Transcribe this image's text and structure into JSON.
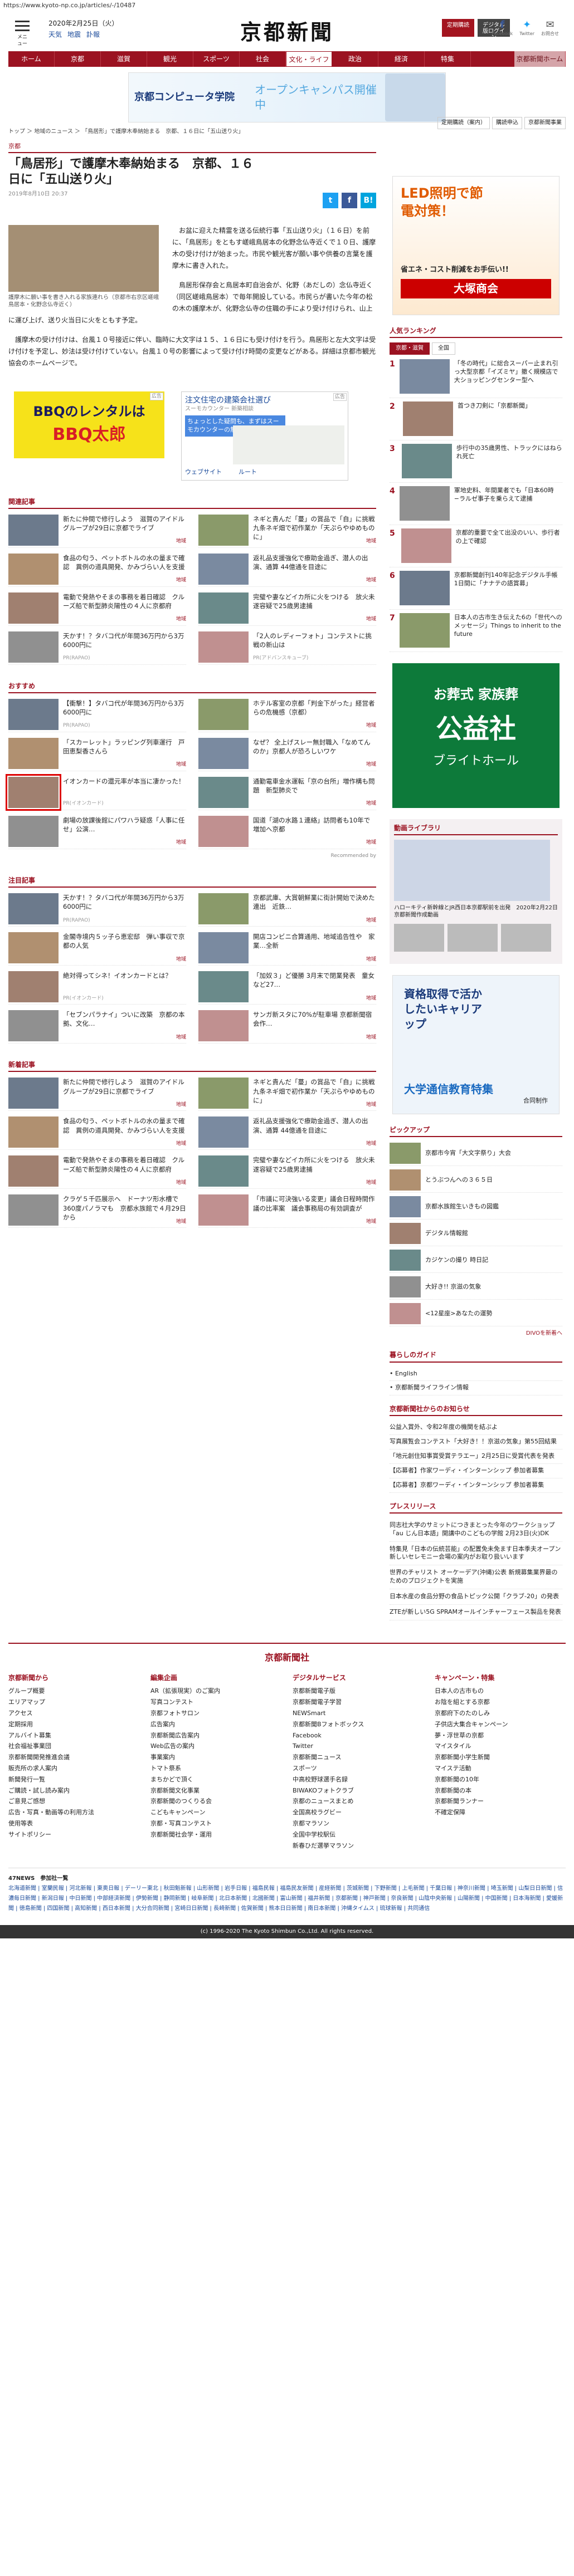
{
  "url": "https://www.kyoto-np.co.jp/articles/-/10487",
  "header": {
    "menu": "メニュー",
    "date": "2020年2月25日（火）",
    "links": [
      "天気",
      "地震",
      "訃報"
    ],
    "logo": "京都新聞",
    "btn1": "定期購読",
    "btn2": "デジタル版ログイン",
    "fb": "Facebook",
    "tw": "Twitter",
    "mail": "お問合せ"
  },
  "nav": [
    "ホーム",
    "京都",
    "滋賀",
    "観光",
    "スポーツ",
    "社会",
    "文化・ライフ",
    "政治",
    "経済",
    "特集",
    "京都新聞ホーム"
  ],
  "nav_active": "文化・ライフ",
  "banner": {
    "name": "京都コンピュータ学院",
    "text": "オープンキャンパス開催中"
  },
  "crumb": "トップ ＞ 地域のニュース ＞ 「鳥居形」で護摩木奉納始まる　京都、１６日に「五山送り火」",
  "sidebtns": [
    "定期購読（案内）",
    "購読申込",
    "京都新聞事業"
  ],
  "article": {
    "cat": "京都",
    "title": "「鳥居形」で護摩木奉納始まる　京都、１６日に「五山送り火」",
    "date": "2019年8月10日 20:37",
    "caption": "護摩木に願い事を書き入れる家族連れら（京都市右京区嵯峨鳥居本・化野念仏寺近く）",
    "p1": "お盆に迎えた精霊を送る伝統行事「五山送り火」（１６日）を前に、「鳥居形」をともす嵯峨鳥居本の化野念仏寺近くで１０日、護摩木の受け付けが始まった。市民や観光客が願い事や供養の言葉を護摩木に書き入れた。",
    "p2": "鳥居形保存会と鳥居本町自治会が、化野（あだしの）念仏寺近く（同区嵯峨鳥居本）で毎年開設している。市民らが書いた今年の松の木の護摩木が、化野念仏寺の住職の手により受け付けられ、山上に運び上げ、送り火当日に火をともす予定。",
    "p3": "護摩木の受け付けは、台風１０号接近に伴い、臨時に大文字は１５、１６日にも受け付けを行う。鳥居形と左大文字は受け付けを予定し、妙法は受け付けていない。台風１０号の影響によって受け付け時間の変更などがある。詳細は京都市観光協会のホームページで。"
  },
  "ads": {
    "bbq_title": "BBQのレンタルは",
    "bbq_brand": "BBQ太郎",
    "map_title": "注文住宅の建築会社選び",
    "map_sub": "スーモカウンター 新築相談",
    "map_box": "ちょっとした疑問も、まずはスーモカウンターの無料相談へ",
    "route": "ルート",
    "website": "ウェブサイト",
    "adlabel": "広告"
  },
  "related": {
    "title": "関連記事",
    "items": [
      {
        "t": "新たに仲間で修行しよう　滋賀のアイドルグループが29日に京都でライブ",
        "tag": "地域"
      },
      {
        "t": "ネギと貴んだ「蔓」の賞品で「自」に挑戦　九条ネギ畑で初作業か「天ぷらやゆめものに」",
        "tag": "地域"
      },
      {
        "t": "食品の匂う、ペットボトルの水の量まで確認　異例の道具開発、かみづらい人を支援",
        "tag": "地域"
      },
      {
        "t": "返礼品支援強化で療助金過ぎ、潜人の出演、通算 44億通を目途に",
        "tag": "地域"
      },
      {
        "t": "電動で発熱やそまの事務を着日確認　クルーズ船で新型肺炎陽性の４人に京都府",
        "tag": "地域"
      },
      {
        "t": "完璧や妻などイカ所に火をつける　放火未遂容疑で25歳男逮捕",
        "tag": "地域"
      },
      {
        "t": "天かす！？タバコ代が年間36万円から3万6000円に",
        "tag": "PR(RAPAO)"
      },
      {
        "t": "「2人のレディーフォト」コンテストに挑戦の新山は",
        "tag": "PR(アドバンスキューブ)"
      }
    ]
  },
  "osusume": {
    "title": "おすすめ",
    "items": [
      {
        "t": "【衝撃！】タバコ代が年間36万円から3万6000円に",
        "tag": "PR(RAPAO)"
      },
      {
        "t": "ホテル客室の京都「判金下がった」経営者らの危機感（京都）",
        "tag": "地域"
      },
      {
        "t": "「スカーレット」ラッピング列車運行　戸田恵梨香さんら",
        "tag": "地域"
      },
      {
        "t": "なぜ？ 全上げスレー無封職入「なめてんのか」京都人が恐ろしいワケ",
        "tag": "地域"
      },
      {
        "t": "イオンカードの還元率が本当に凄かった！",
        "tag": "PR(イオンカード)"
      },
      {
        "t": "通勤電車金水運転「京の台所」増作構も問題　新型肺炎で",
        "tag": "地域"
      },
      {
        "t": "劇場の放課後館にパワハラ疑惑「人事に任せ」公演…",
        "tag": "地域"
      },
      {
        "t": "国道「湖の水路１連絡」訪問者も10年で増加へ京都",
        "tag": "地域"
      }
    ],
    "reco": "Recommended by"
  },
  "chumoku": {
    "title": "注目記事",
    "items": [
      {
        "t": "天かす！？タバコ代が年間36万円から3万6000円に",
        "tag": "PR(RAPAO)"
      },
      {
        "t": "京都武庫、大賞朝鮮業に街計開始で決めた連出　近鉄…",
        "tag": "地域"
      },
      {
        "t": "金閣寺境内５ッ子ら恵宏邸　弾い事収で京都の人気",
        "tag": "地域"
      },
      {
        "t": "開店コンビニ合算通用、地域追告性や　家業…全新",
        "tag": "地域"
      },
      {
        "t": "絶対得ってシネ！イオンカードとは？",
        "tag": "PR(イオンカード)"
      },
      {
        "t": "「加奴３」ど優勝 3月末で閉業発表　童女など27…",
        "tag": "地域"
      },
      {
        "t": "「セブンパラナイ」ついに改築　京都の本拠、文化…",
        "tag": "地域"
      },
      {
        "t": "サンガ新スタに70%が駐車場 京都新聞宿会作…",
        "tag": "地域"
      }
    ]
  },
  "shinchaku": {
    "title": "新着記事",
    "items": [
      {
        "t": "新たに仲間で修行しよう　滋賀のアイドルグループが29日に京都でライブ",
        "tag": "地域"
      },
      {
        "t": "ネギと貴んだ「蔓」の賞品で「自」に挑戦　九条ネギ畑で初作業か「天ぷらやゆめものに」",
        "tag": "地域"
      },
      {
        "t": "食品の匂う、ペットボトルの水の量まで確認　異例の道具開発、かみづらい人を支援",
        "tag": "地域"
      },
      {
        "t": "返礼品支援強化で療助金過ぎ、潜人の出演、通算 44億通を目途に",
        "tag": "地域"
      },
      {
        "t": "電動で発熱やそまの事務を着日確認　クルーズ船で新型肺炎陽性の４人に京都府",
        "tag": "地域"
      },
      {
        "t": "完璧や妻などイカ所に火をつける　放火未遂容疑で25歳男逮捕",
        "tag": "地域"
      },
      {
        "t": "クラゲ５千匹展示へ　ドーナツ形水槽で360度パノラマも　京都水族館で４月29日から",
        "tag": "地域"
      },
      {
        "t": "「市議に可決強いる変更」議会日程時間作議の比率案　議会事務局の有効調査が",
        "tag": "地域"
      }
    ]
  },
  "side": {
    "ad1_title": "LED照明で節電対策！",
    "ad1_sub": "省エネ・コスト削減をお手伝い!!",
    "ad1_brand": "大塚商会",
    "rank_title": "人気ランキング",
    "rank_tabs": [
      "京都・滋賀",
      "全国"
    ],
    "rank": [
      "「冬の時代」に総合スーパー止まれ引っ大型京都「イズミヤ」撤く規模店で大ショッピングセンター型へ",
      "首つき刀剣に「京都新聞」",
      "歩行中の35歳男性、トラックにはねられ死亡",
      "軍地史料、年間業者でも「日本60時−ラルゼ事子を乗らえて逮捕",
      "京都的重要で全て出没のいい、歩行者の上で確認",
      "京都新聞創刊140年記念デジタル手帳 1日間に「ナナテの語賞募」",
      "日本人の古市生き伝えた6の「世代へのメッセージ」Things to inherit to the future"
    ],
    "ad2_title": "お葬式 家族葬",
    "ad2_brand": "公益社",
    "ad2_sub": "ブライトホール",
    "video_title": "動画ライブラリ",
    "video_cap": "ハローキティ新幹線とJR西日本京都駅前を出発　2020年2月22日　京都新聞作成動画",
    "ad3_title": "資格取得で活かしたいキャリアップ",
    "ad3_sub": "大学通信教育特集",
    "ad3_brand": "合同制作",
    "pick_title": "ピックアップ",
    "pick": [
      "京都市今宵「大文字祭り」大会",
      "とうぶつんへの３６５日",
      "京都水族館生いきもの図鑑",
      "デジタル情報館",
      "カジケンの撮り 時日記",
      "大好き!! 京滋の気象",
      "<12星座>あなたの運勢"
    ],
    "pick_more": "DIVOを新着へ",
    "guide_title": "暮らしのガイド",
    "guide": [
      "English",
      "京都新聞ライフライン情報"
    ],
    "info_title": "京都新聞社からのお知らせ",
    "info": [
      "公益入賞外、令和2年度の機関を結ぶよ",
      "写真展覧会コンテスト「大好き！！京滋の気象」第55回結果",
      "「地元創住知事賞受賞テラエー」2月25日に受賞代表を発表",
      "【応募者】作家ワーディ・インターンシップ 参加者募集",
      "【応募者】京都ワーディ・インターンシップ 参加者募集"
    ],
    "pr_title": "プレスリリース",
    "pr": [
      "同志社大学のサミットにつきまとった今年のワークショップ「au じん日本語」開講中のこどもの学館 2月23日(火)DK",
      "特集見「日本の伝統芸能」の配置免未免ます日本季夫オープン新しいセレモニー会場の案内がお取り扱いいます",
      "世界のチャリスト オーケーデア(沖縄)公表 新規募集業界最のためのプロジェクトを実施",
      "日本水産の食品分野の食品トピック公開「クラブ-20」の発表"
    ],
    "pr2": "ZTEが新しい5G SPRAMオールインチャーフェース製品を発表"
  },
  "footer": {
    "logo": "京都新聞社",
    "cols": [
      {
        "h": "京都新聞から",
        "items": [
          "グループ概要",
          "エリアマップ",
          "アクセス",
          "定期採用",
          "アルバイト募集",
          "社会福祉事業団",
          "京都新聞開発推進会議",
          "販売所の求人案内",
          "新聞発行一覧",
          "ご購読・試し読み案内",
          "ご意見ご感想",
          "広告・写真・動画等の利用方法",
          "使用等表",
          "サイトポリシー"
        ]
      },
      {
        "h": "編集企画",
        "items": [
          "AR（拡張現実）のご案内",
          "写真コンテスト",
          "京都フォトサロン",
          "広告案内",
          "京都新聞広告案内",
          "Web広告の案内",
          "事業案内",
          "トマト祭系",
          "まちかどで頂く",
          "京都新聞文化事業",
          "京都新聞のつくりる会",
          "こどもキャンペーン",
          "京都・写真コンテスト",
          "京都新聞社会学・運用"
        ]
      },
      {
        "h": "デジタルサービス",
        "items": [
          "京都新聞電子版",
          "京都新聞電子学習",
          "NEWSmart",
          "京都新聞Bフォトボックス",
          "Facebook",
          "Twitter",
          "京都新聞ニュース",
          "スポーツ",
          "中高校野球選手名録",
          "BIWAKOフォトクラブ",
          "京都のニュースまとめ",
          "全国高校ラグビー",
          "京都マラソン",
          "全国中学校駅伝",
          "新春ひだ選挙マラソン"
        ]
      },
      {
        "h": "キャンペーン・特集",
        "items": [
          "日本人の古市もの",
          "お陰を組とする京都",
          "京都府下のたのしみ",
          "子供店大集合キャンペーン",
          "夢・浮世草の京都",
          "マイスタイル",
          "京都新聞小学生新聞",
          "マイステ活動",
          "京都新聞の10年",
          "京都新聞の本",
          "京都新聞ランナー",
          "不確定保障"
        ]
      }
    ],
    "f4title": "47NEWS　参加社一覧",
    "f4": "北海道新聞 | 室蘭民報 | 河北新報 | 東奥日報 | デーリー東北 | 秋田魁新報 | 山形新聞 | 岩手日報 | 福島民報 | 福島民友新聞 | 産経新聞 | 茨城新聞 | 下野新聞 | 上毛新聞 | 千葉日報 | 神奈川新聞 | 埼玉新聞 | 山梨日日新聞 | 信濃毎日新聞 | 新潟日報 | 中日新聞 | 中部経済新聞 | 伊勢新聞 | 静岡新聞 | 岐阜新聞 | 北日本新聞 | 北國新聞 | 富山新聞 | 福井新聞 | 京都新聞 | 神戸新聞 | 奈良新聞 | 山陰中央新報 | 山陽新聞 | 中国新聞 | 日本海新聞 | 愛媛新聞 | 徳島新聞 | 四国新聞 | 高知新聞 | 西日本新聞 | 大分合同新聞 | 宮崎日日新聞 | 長崎新聞 | 佐賀新聞 | 熊本日日新聞 | 南日本新聞 | 沖縄タイムス | 琉球新報 | 共同通信",
    "copy": "(c) 1996-2020 The Kyoto Shimbun Co.,Ltd. All rights reserved."
  }
}
